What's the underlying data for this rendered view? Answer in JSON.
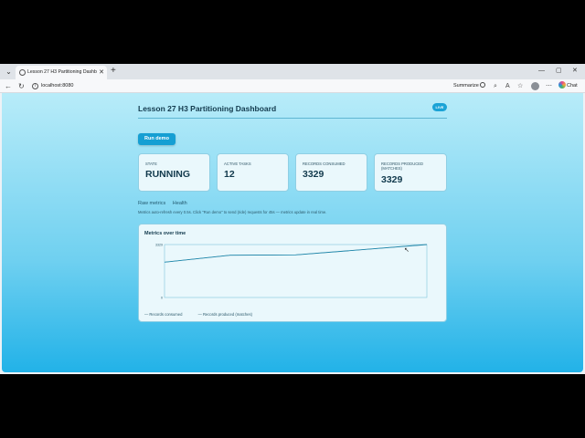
{
  "browser": {
    "tab_title": "Lesson 27 H3 Partitioning Dashbo",
    "new_tab": "+",
    "url": "localhost:8080",
    "summarize_label": "Summarize",
    "chat_label": "Chat"
  },
  "dashboard": {
    "title": "Lesson 27 H3 Partitioning Dashboard",
    "live_badge": "LIVE",
    "run_button": "Run demo",
    "cards": [
      {
        "label": "STATE",
        "value": "RUNNING"
      },
      {
        "label": "ACTIVE TASKS",
        "value": "12"
      },
      {
        "label": "RECORDS CONSUMED",
        "value": "3329"
      },
      {
        "label": "RECORDS PRODUCED (MATCHES)",
        "value": "3329"
      }
    ],
    "links": [
      "Raw metrics",
      "Health"
    ],
    "note": "Metrics auto-refresh every 0.5s. Click \"Run demo\" to send (ride) requests for 45s — metrics update in real time."
  },
  "chart_data": {
    "type": "line",
    "title": "Metrics over time",
    "ylim": [
      0,
      3329
    ],
    "y_tick_labels": [
      "0",
      "3329"
    ],
    "x": [
      0,
      1,
      2,
      3,
      4
    ],
    "series": [
      {
        "name": "Records consumed",
        "values": [
          2220,
          2660,
          2680,
          3000,
          3329
        ],
        "color": "#1a6a86"
      },
      {
        "name": "Records produced (matches)",
        "values": [
          2220,
          2660,
          2680,
          3000,
          3329
        ],
        "color": "#2aa0c8"
      }
    ],
    "legend": "bottom-left"
  }
}
